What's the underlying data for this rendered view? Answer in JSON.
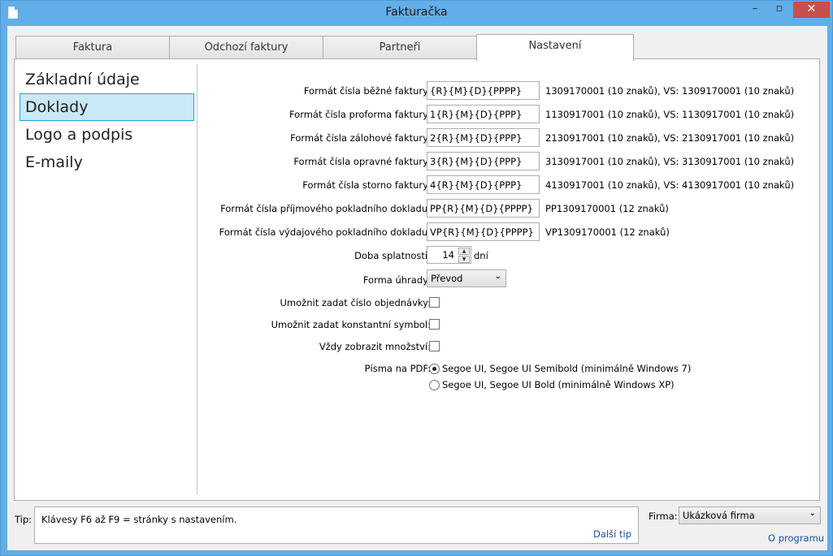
{
  "window": {
    "title": "Fakturačka",
    "minimize": "–",
    "maximize": "▫",
    "close": "✕"
  },
  "tabs": [
    {
      "label": "Faktura"
    },
    {
      "label": "Odchozí faktury"
    },
    {
      "label": "Partneři"
    },
    {
      "label": "Nastavení",
      "active": true
    }
  ],
  "nav": {
    "items": [
      {
        "label": "Základní údaje"
      },
      {
        "label": "Doklady",
        "selected": true
      },
      {
        "label": "Logo a podpis"
      },
      {
        "label": "E-maily"
      }
    ]
  },
  "form": {
    "formats": [
      {
        "label": "Formát čísla běžné faktury:",
        "value": "{R}{M}{D}{PPPP}",
        "hint": "1309170001 (10 znaků), VS: 1309170001 (10 znaků)"
      },
      {
        "label": "Formát čísla proforma faktury:",
        "value": "1{R}{M}{D}{PPP}",
        "hint": "1130917001 (10 znaků), VS: 1130917001 (10 znaků)"
      },
      {
        "label": "Formát čísla zálohové faktury:",
        "value": "2{R}{M}{D}{PPP}",
        "hint": "2130917001 (10 znaků), VS: 2130917001 (10 znaků)"
      },
      {
        "label": "Formát čísla opravné faktury:",
        "value": "3{R}{M}{D}{PPP}",
        "hint": "3130917001 (10 znaků), VS: 3130917001 (10 znaků)"
      },
      {
        "label": "Formát čísla storno faktury:",
        "value": "4{R}{M}{D}{PPP}",
        "hint": "4130917001 (10 znaků), VS: 4130917001 (10 znaků)"
      },
      {
        "label": "Formát čísla příjmového pokladního dokladu:",
        "value": "PP{R}{M}{D}{PPPP}",
        "hint": "PP1309170001 (12 znaků)"
      },
      {
        "label": "Formát čísla výdajového pokladního dokladu:",
        "value": "VP{R}{M}{D}{PPPP}",
        "hint": "VP1309170001 (12 znaků)"
      }
    ],
    "due": {
      "label": "Doba splatnosti:",
      "value": "14",
      "unit": "dní",
      "up": "▲",
      "down": "▼"
    },
    "payment": {
      "label": "Forma úhrady:",
      "value": "Převod",
      "chevron": "⌄"
    },
    "order_number": {
      "label": "Umožnit zadat číslo objednávky:",
      "checked": false
    },
    "constant_symbol": {
      "label": "Umožnit zadat konstantní symbol:",
      "checked": false
    },
    "show_quantity": {
      "label": "Vždy zobrazit množství:",
      "checked": false
    },
    "pdf_fonts": {
      "label": "Písma na PDF:",
      "options": [
        {
          "label": "Segoe UI, Segoe UI Semibold (minimálně Windows 7)",
          "selected": true
        },
        {
          "label": "Segoe UI, Segoe UI Bold (minimálně Windows XP)",
          "selected": false
        }
      ]
    }
  },
  "footer": {
    "tip_label": "Tip:",
    "tip_text": "Klávesy F6 až F9 = stránky s nastavením.",
    "next_tip": "Další tip",
    "firm_label": "Firma:",
    "firm_value": "Ukázková firma",
    "firm_chevron": "⌄",
    "about": "O programu"
  }
}
